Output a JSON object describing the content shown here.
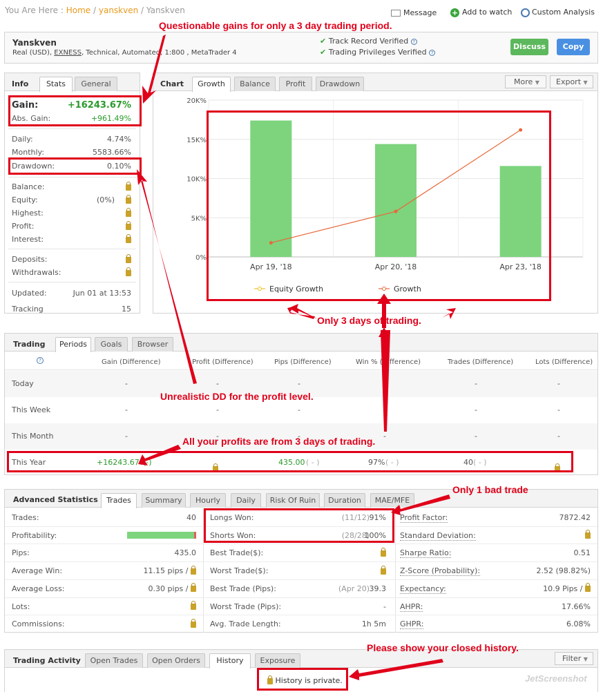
{
  "breadcrumb": {
    "prefix": "You Are Here :",
    "home": "Home",
    "sep": "/",
    "user": "yanskven",
    "current": "Yanskven"
  },
  "top_actions": {
    "message": "Message",
    "add_watch": "Add to watch",
    "custom_analysis": "Custom Analysis"
  },
  "account": {
    "name": "Yanskven",
    "details_pre": "Real (USD),",
    "broker": "EXNESS",
    "details_post": ", Technical, Automated, 1:800 , MetaTrader 4",
    "track_record": "Track Record Verified",
    "trading_privileges": "Trading Privileges Verified",
    "discuss": "Discuss",
    "copy": "Copy"
  },
  "info": {
    "title": "Info",
    "tabs": [
      "Stats",
      "General"
    ],
    "gain_label": "Gain:",
    "gain_value": "+16243.67%",
    "abs_gain_label": "Abs. Gain:",
    "abs_gain_value": "+961.49%",
    "daily_label": "Daily:",
    "daily_value": "4.74%",
    "monthly_label": "Monthly:",
    "monthly_value": "5583.66%",
    "drawdown_label": "Drawdown:",
    "drawdown_value": "0.10%",
    "balance_label": "Balance:",
    "equity_label": "Equity:",
    "equity_value": "(0%)",
    "highest_label": "Highest:",
    "profit_label": "Profit:",
    "interest_label": "Interest:",
    "deposits_label": "Deposits:",
    "withdrawals_label": "Withdrawals:",
    "updated_label": "Updated:",
    "updated_value": "Jun 01 at 13:53",
    "tracking_label": "Tracking",
    "tracking_value": "15"
  },
  "chart_panel": {
    "title": "Chart",
    "tabs": [
      "Growth",
      "Balance",
      "Profit",
      "Drawdown"
    ],
    "more": "More",
    "export": "Export"
  },
  "chart_data": {
    "type": "bar",
    "categories": [
      "Apr 19, '18",
      "Apr 20, '18",
      "Apr 23, '18"
    ],
    "series": [
      {
        "name": "Equity Growth",
        "type": "bar",
        "values": [
          17400,
          14400,
          11600
        ]
      },
      {
        "name": "Growth",
        "type": "line",
        "values": [
          1800,
          5800,
          16200
        ]
      }
    ],
    "ylim": [
      0,
      20000
    ],
    "yticks": [
      "0%",
      "5K%",
      "10K%",
      "15K%",
      "20K%"
    ],
    "legend": "bottom",
    "colors": {
      "bar": "#7dd47d",
      "line": "#e8683a",
      "legend_equity": "#f0c020"
    }
  },
  "trading": {
    "title": "Trading",
    "tabs": [
      "Periods",
      "Goals",
      "Browser"
    ],
    "help": "?",
    "headers": [
      "Gain (Difference)",
      "Profit (Difference)",
      "Pips (Difference)",
      "Win % (Difference)",
      "Trades (Difference)",
      "Lots (Difference)"
    ],
    "rows": [
      {
        "label": "Today",
        "dash": "-"
      },
      {
        "label": "This Week",
        "dash": "-"
      },
      {
        "label": "This Month",
        "dash": "-"
      }
    ],
    "year": {
      "label": "This Year",
      "gain": "+16243.67%",
      "gain_diff": "(-)",
      "pips": "435.00",
      "pips_diff": "( - )",
      "win": "97%",
      "win_diff": "( - )",
      "trades": "40",
      "trades_diff": "( - )"
    }
  },
  "adv": {
    "title": "Advanced Statistics",
    "tabs": [
      "Trades",
      "Summary",
      "Hourly",
      "Daily",
      "Risk Of Ruin",
      "Duration",
      "MAE/MFE"
    ],
    "col1": [
      {
        "l": "Trades:",
        "v": "40"
      },
      {
        "l": "Profitability:",
        "v": ""
      },
      {
        "l": "Pips:",
        "v": "435.0"
      },
      {
        "l": "Average Win:",
        "v": "11.15 pips /"
      },
      {
        "l": "Average Loss:",
        "v": "0.30 pips /"
      },
      {
        "l": "Lots:",
        "v": ""
      },
      {
        "l": "Commissions:",
        "v": ""
      }
    ],
    "col2": [
      {
        "l": "Longs Won:",
        "p": "(11/12)",
        "v": "91%"
      },
      {
        "l": "Shorts Won:",
        "p": "(28/28)",
        "v": "100%"
      },
      {
        "l": "Best Trade($):",
        "p": "",
        "v": ""
      },
      {
        "l": "Worst Trade($):",
        "p": "",
        "v": ""
      },
      {
        "l": "Best Trade (Pips):",
        "p": "(Apr 20)",
        "v": "39.3"
      },
      {
        "l": "Worst Trade (Pips):",
        "p": "",
        "v": "-"
      },
      {
        "l": "Avg. Trade Length:",
        "p": "",
        "v": "1h 5m"
      }
    ],
    "col3": [
      {
        "l": "Profit Factor:",
        "v": "7872.42"
      },
      {
        "l": "Standard Deviation:",
        "v": ""
      },
      {
        "l": "Sharpe Ratio:",
        "v": "0.51"
      },
      {
        "l": "Z-Score (Probability):",
        "v": "2.52 (98.82%)"
      },
      {
        "l": "Expectancy:",
        "v": "10.9 Pips /"
      },
      {
        "l": "AHPR:",
        "v": "17.66%"
      },
      {
        "l": "GHPR:",
        "v": "6.08%"
      }
    ],
    "profitability_fraction": 0.97
  },
  "activity": {
    "title": "Trading Activity",
    "tabs": [
      "Open Trades",
      "Open Orders",
      "History",
      "Exposure"
    ],
    "filter": "Filter",
    "private": "History is private."
  },
  "annotations": {
    "a1": "Questionable gains for only a 3 day trading period.",
    "a2": "Only 3 days of trading.",
    "a3": "Unrealistic DD for the profit level.",
    "a4": "All your profits are from 3 days of trading.",
    "a5": "Only 1 bad trade",
    "a6": "Please show your closed history."
  },
  "watermark": "JetScreenshot"
}
